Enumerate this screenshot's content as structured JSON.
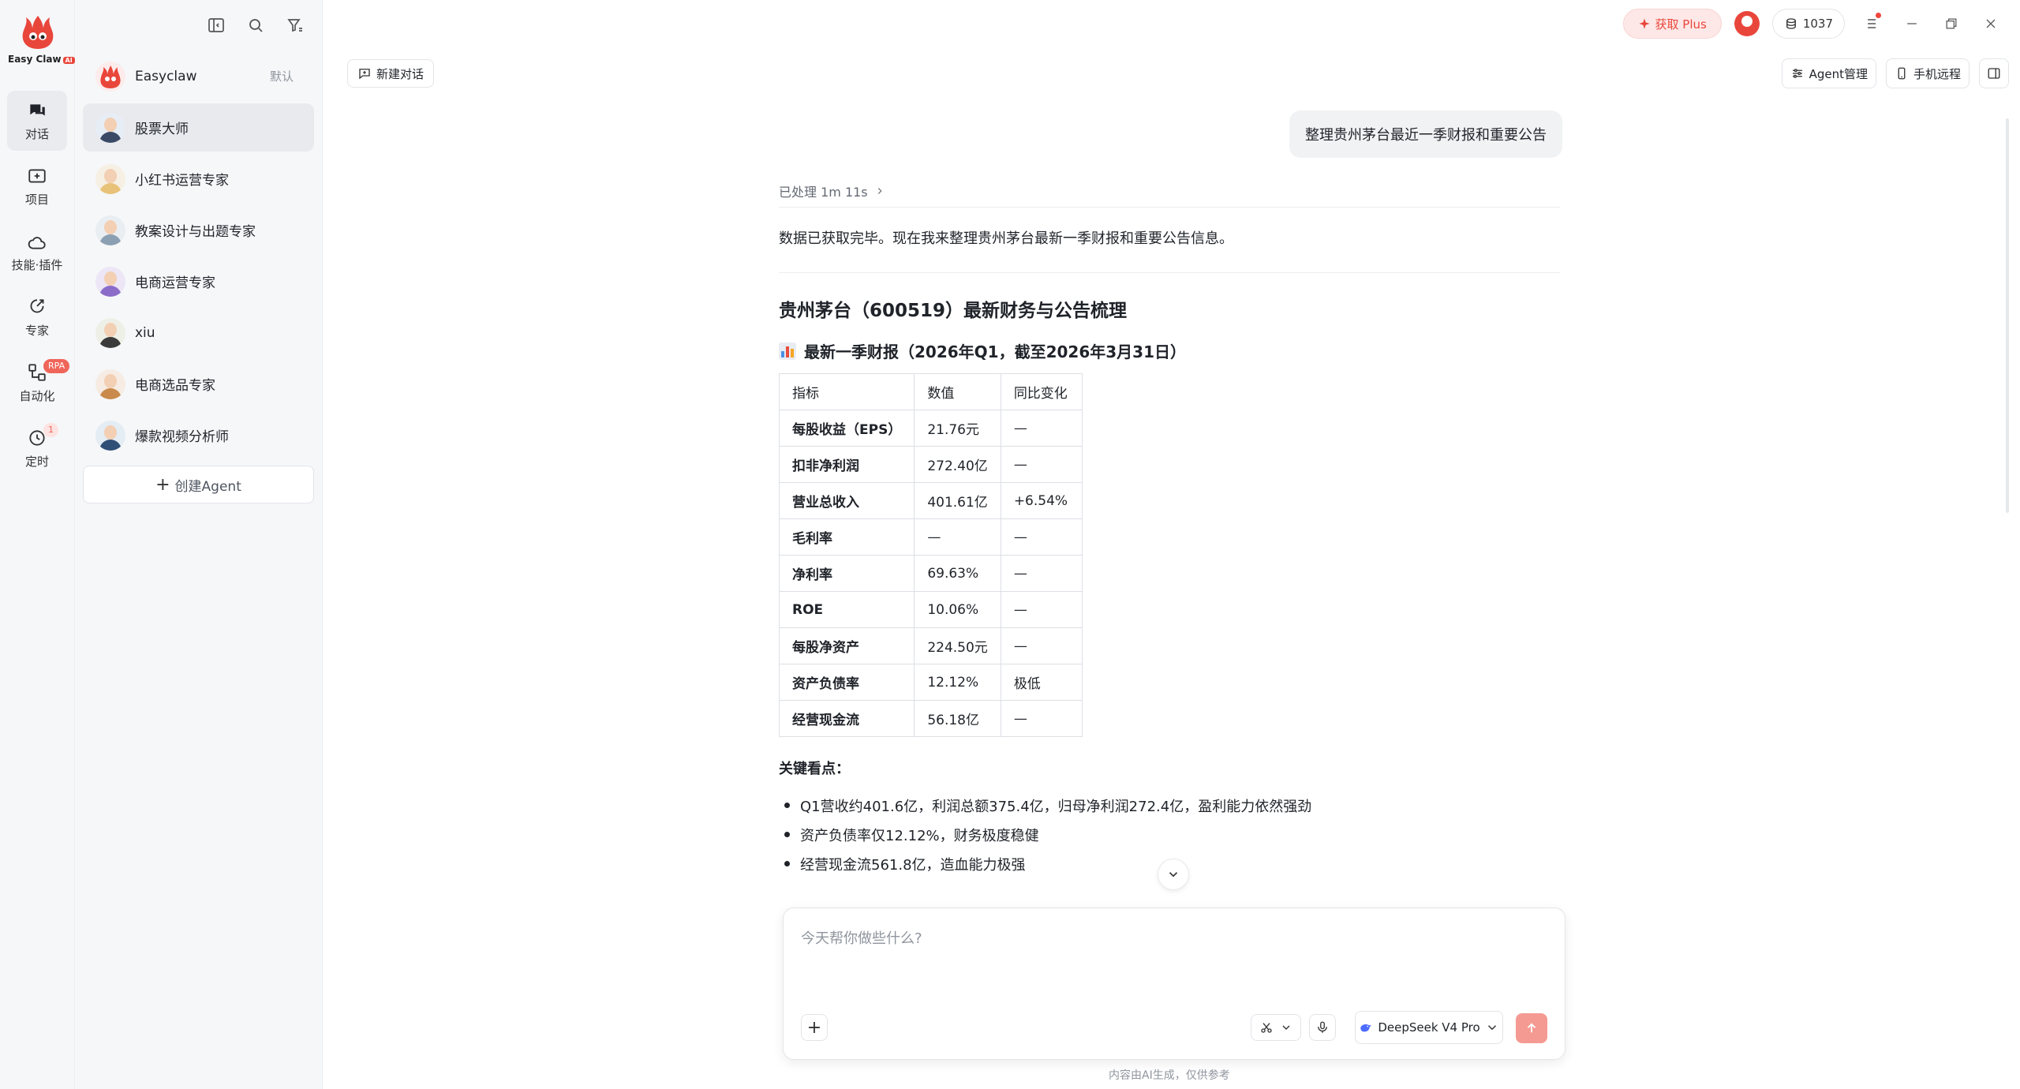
{
  "app": {
    "logo_text": "Easy Claw",
    "logo_tag": "AI"
  },
  "rail": {
    "items": [
      {
        "label": "对话",
        "icon": "chat-icon"
      },
      {
        "label": "项目",
        "icon": "folder-plus-icon"
      },
      {
        "label": "技能·插件",
        "icon": "puzzle-icon"
      },
      {
        "label": "专家",
        "icon": "expert-icon"
      },
      {
        "label": "自动化",
        "icon": "workflow-icon",
        "badge": "RPA"
      },
      {
        "label": "定时",
        "icon": "clock-icon",
        "badge": "1"
      }
    ]
  },
  "sidebar": {
    "agents": [
      {
        "name": "Easyclaw",
        "tag": "默认"
      },
      {
        "name": "股票大师"
      },
      {
        "name": "小红书运营专家"
      },
      {
        "name": "教案设计与出题专家"
      },
      {
        "name": "电商运营专家"
      },
      {
        "name": "xiu"
      },
      {
        "name": "电商选品专家"
      },
      {
        "name": "爆款视频分析师"
      }
    ],
    "create_label": "创建Agent"
  },
  "topbar": {
    "plus_label": "获取 Plus",
    "credits": "1037",
    "new_chat": "新建对话",
    "agent_manage": "Agent管理",
    "phone_remote": "手机远程"
  },
  "chat": {
    "user_message": "整理贵州茅台最近一季财报和重要公告",
    "processed": "已处理 1m 11s",
    "intro": "数据已获取完毕。现在我来整理贵州茅台最新一季财报和重要公告信息。",
    "heading": "贵州茅台（600519）最新财务与公告梳理",
    "subheading": "最新一季财报（2026年Q1，截至2026年3月31日）",
    "table": {
      "headers": [
        "指标",
        "数值",
        "同比变化"
      ],
      "rows": [
        [
          "每股收益（EPS）",
          "21.76元",
          "—"
        ],
        [
          "扣非净利润",
          "272.40亿",
          "—"
        ],
        [
          "营业总收入",
          "401.61亿",
          "+6.54%"
        ],
        [
          "毛利率",
          "—",
          "—"
        ],
        [
          "净利率",
          "69.63%",
          "—"
        ],
        [
          "ROE",
          "10.06%",
          "—"
        ],
        [
          "每股净资产",
          "224.50元",
          "—"
        ],
        [
          "资产负债率",
          "12.12%",
          "极低"
        ],
        [
          "经营现金流",
          "56.18亿",
          "—"
        ]
      ]
    },
    "key_points_title": "关键看点：",
    "key_points": [
      "Q1营收约401.6亿，利润总额375.4亿，归母净利润272.4亿，盈利能力依然强劲",
      "资产负债率仅12.12%，财务极度稳健",
      "经营现金流561.8亿，造血能力极强"
    ]
  },
  "composer": {
    "placeholder": "今天帮你做些什么?",
    "model": "DeepSeek V4 Pro",
    "disclaimer": "内容由AI生成，仅供参考"
  },
  "colors": {
    "brand": "#e9463b",
    "send": "#f59a92"
  }
}
